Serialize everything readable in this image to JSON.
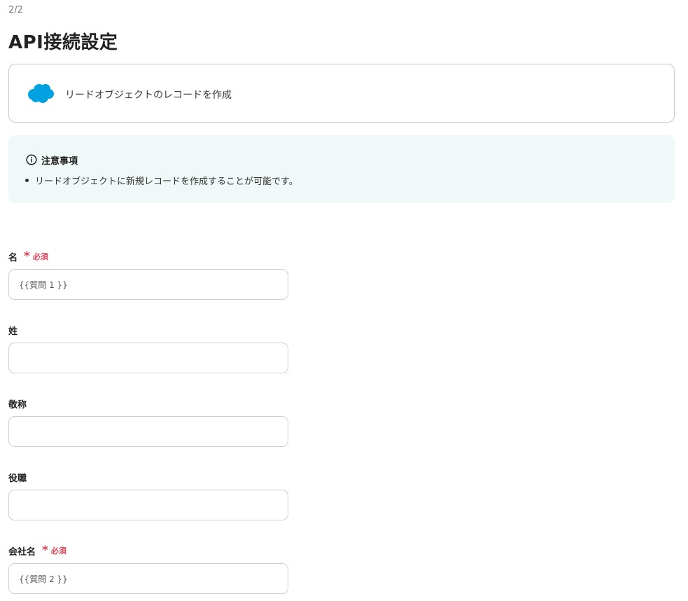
{
  "header": {
    "step": "2/2",
    "title": "API接続設定"
  },
  "action": {
    "icon": "salesforce-cloud-icon",
    "brand_color": "#00a1e0",
    "label": "リードオブジェクトのレコードを作成"
  },
  "notice": {
    "icon": "info-circle-icon",
    "title": "注意事項",
    "items": [
      "リードオブジェクトに新規レコードを作成することが可能です。"
    ],
    "background_color": "#f1f9f8"
  },
  "required_color": "#e0455a",
  "fields": [
    {
      "label": "名",
      "required": true,
      "required_label": "必須",
      "value": "{{質問 1 }}"
    },
    {
      "label": "姓",
      "required": false,
      "value": ""
    },
    {
      "label": "敬称",
      "required": false,
      "value": ""
    },
    {
      "label": "役職",
      "required": false,
      "value": ""
    },
    {
      "label": "会社名",
      "required": true,
      "required_label": "必須",
      "value": "{{質問 2 }}"
    }
  ]
}
